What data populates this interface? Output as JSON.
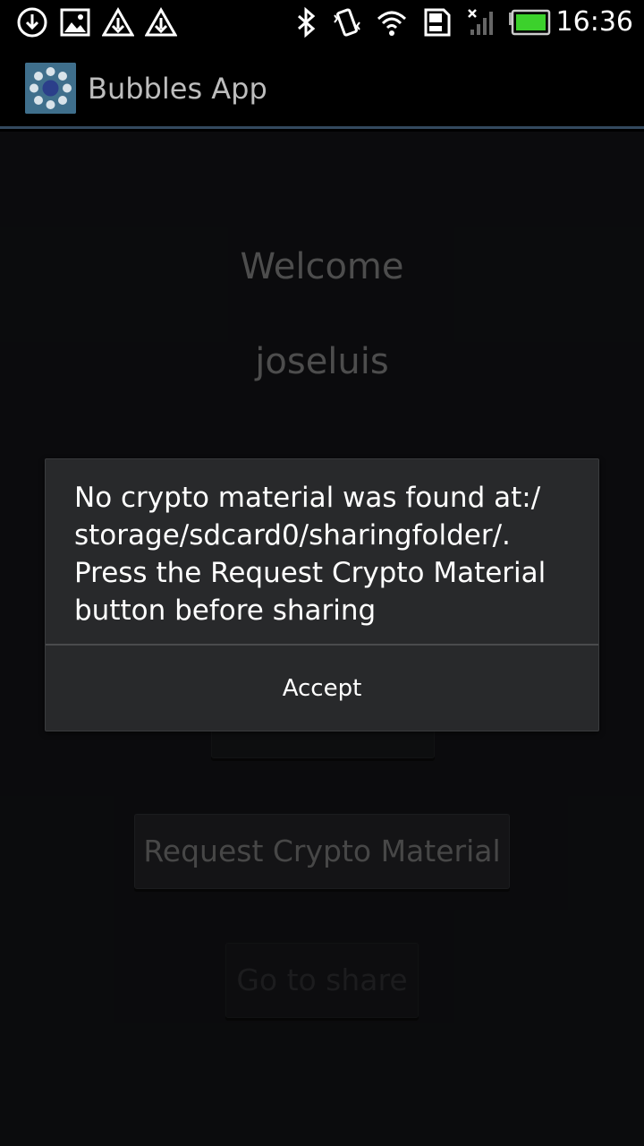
{
  "status_bar": {
    "left_icons": [
      "download-icon",
      "image-icon",
      "warning-icon",
      "warning-icon"
    ],
    "right_icons": [
      "bluetooth-icon",
      "vibrate-icon",
      "wifi-icon",
      "sd-card-icon",
      "no-signal-icon",
      "battery-icon"
    ],
    "time": "16:36"
  },
  "action_bar": {
    "app_icon": "bubbles-app-icon",
    "title": "Bubbles App"
  },
  "main": {
    "welcome": "Welcome",
    "username": "joseluis",
    "request_button": "Request Crypto Material",
    "share_button": "Go to share"
  },
  "dialog": {
    "message": "No crypto material was found at:/ storage/sdcard0/sharingfolder/. Press the Request Crypto Material button before sharing",
    "accept_button": "Accept"
  }
}
